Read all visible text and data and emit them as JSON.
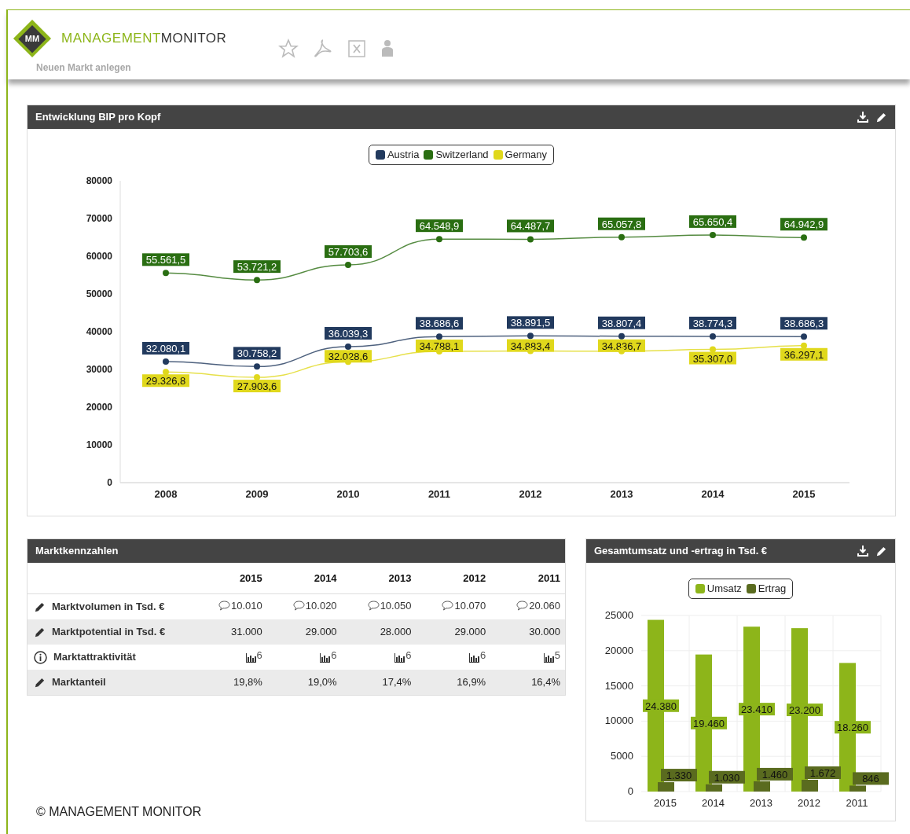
{
  "header": {
    "logo_mark": "MM",
    "brand_first": "MANAGEMENT",
    "brand_second": "MONITOR",
    "faded_action": "Neuen Markt anlegen"
  },
  "gdp_panel": {
    "title": "Entwicklung BIP pro Kopf",
    "chart_data": {
      "type": "line",
      "categories": [
        "2008",
        "2009",
        "2010",
        "2011",
        "2012",
        "2013",
        "2014",
        "2015"
      ],
      "legend": true,
      "series": [
        {
          "name": "Austria",
          "color": "#223a5e",
          "marker": true,
          "values": [
            32080.1,
            30758.2,
            36039.3,
            38686.6,
            38891.5,
            38807.4,
            38774.3,
            38686.3
          ],
          "value_labels": [
            "32.080,1",
            "30.758,2",
            "36.039,3",
            "38.686,6",
            "38.891,5",
            "38.807,4",
            "38.774,3",
            "38.686,3"
          ]
        },
        {
          "name": "Switzerland",
          "color": "#2a6e12",
          "marker": true,
          "values": [
            55561.5,
            53721.2,
            57703.6,
            64548.9,
            64487.7,
            65057.8,
            65650.4,
            64942.9
          ],
          "value_labels": [
            "55.561,5",
            "53.721,2",
            "57.703,6",
            "64.548,9",
            "64.487,7",
            "65.057,8",
            "65.650,4",
            "64.942,9"
          ]
        },
        {
          "name": "Germany",
          "color": "#e0d81c",
          "marker": true,
          "values": [
            29326.8,
            27903.6,
            32028.6,
            34788.1,
            34883.4,
            34836.7,
            35307.0,
            36297.1
          ],
          "value_labels": [
            "29.326,8",
            "27.903,6",
            "32.028,6",
            "34.788,1",
            "34.883,4",
            "34.836,7",
            "35.307,0",
            "36.297,1"
          ]
        }
      ],
      "ylim": [
        0,
        80000
      ],
      "yticks": [
        0,
        10000,
        20000,
        30000,
        40000,
        50000,
        60000,
        70000,
        80000
      ],
      "data_labels": true
    }
  },
  "market_table": {
    "title": "Marktkennzahlen",
    "columns": [
      "2015",
      "2014",
      "2013",
      "2012",
      "2011"
    ],
    "rows": [
      {
        "kind": "comment",
        "label": "Marktvolumen in Tsd. €",
        "cells": [
          "10.010",
          "10.020",
          "10.050",
          "10.070",
          "20.060"
        ]
      },
      {
        "kind": "plain",
        "label": "Marktpotential in Tsd. €",
        "cells": [
          "31.000",
          "29.000",
          "28.000",
          "29.000",
          "30.000"
        ]
      },
      {
        "kind": "rating",
        "label": "Marktattraktivität",
        "cells": [
          "6",
          "6",
          "6",
          "6",
          "5"
        ]
      },
      {
        "kind": "plain",
        "label": "Marktanteil",
        "cells": [
          "19,8%",
          "19,0%",
          "17,4%",
          "16,9%",
          "16,4%"
        ]
      }
    ]
  },
  "revenue_panel": {
    "title": "Gesamtumsatz und -ertrag in Tsd. €",
    "chart_data": {
      "type": "bar",
      "categories": [
        "2015",
        "2014",
        "2013",
        "2012",
        "2011"
      ],
      "legend": true,
      "grid": true,
      "series": [
        {
          "name": "Umsatz",
          "color": "#8db51a",
          "values": [
            24380,
            19460,
            23410,
            23200,
            18260
          ],
          "value_labels": [
            "24.380",
            "19.460",
            "23.410",
            "23.200",
            "18.260"
          ]
        },
        {
          "name": "Ertrag",
          "color": "#5a6b1f",
          "values": [
            1330,
            1030,
            1460,
            1672,
            846
          ],
          "value_labels": [
            "1.330",
            "1.030",
            "1.460",
            "1.672",
            "846"
          ]
        }
      ],
      "ylim": [
        0,
        25000
      ],
      "yticks": [
        0,
        5000,
        10000,
        15000,
        20000,
        25000
      ],
      "data_labels": true
    }
  },
  "footer": "© MANAGEMENT MONITOR"
}
